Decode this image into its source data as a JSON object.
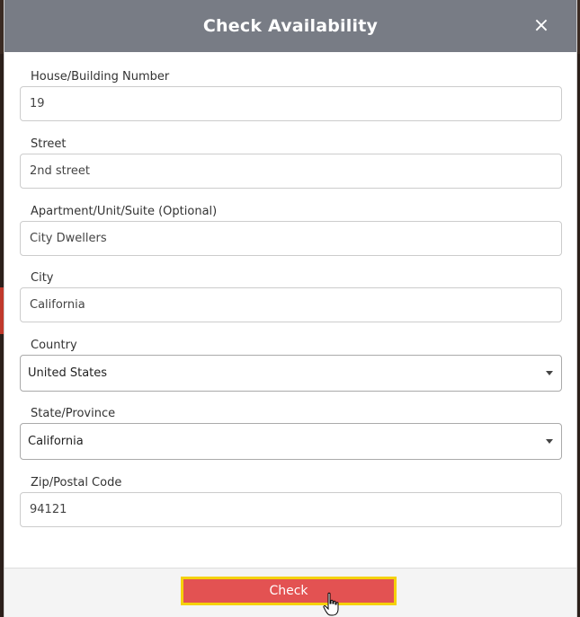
{
  "modal": {
    "title": "Check Availability",
    "close_glyph": "×"
  },
  "fields": [
    {
      "label": "House/Building Number",
      "value": "19",
      "type": "text"
    },
    {
      "label": "Street",
      "value": "2nd street",
      "type": "text"
    },
    {
      "label": "Apartment/Unit/Suite (Optional)",
      "value": "City Dwellers",
      "type": "text"
    },
    {
      "label": "City",
      "value": "California",
      "type": "text"
    },
    {
      "label": "Country",
      "value": "United States",
      "type": "select"
    },
    {
      "label": "State/Province",
      "value": "California",
      "type": "select"
    },
    {
      "label": "Zip/Postal Code",
      "value": "94121",
      "type": "text"
    }
  ],
  "footer": {
    "check_label": "Check",
    "button_color": "#e35252",
    "focus_outline_color": "#f5d10a"
  },
  "colors": {
    "header_bg": "#787c85"
  },
  "icons": {
    "close": "close-icon",
    "dropdown": "chevron-down-icon",
    "cursor": "hand-pointer-icon"
  }
}
